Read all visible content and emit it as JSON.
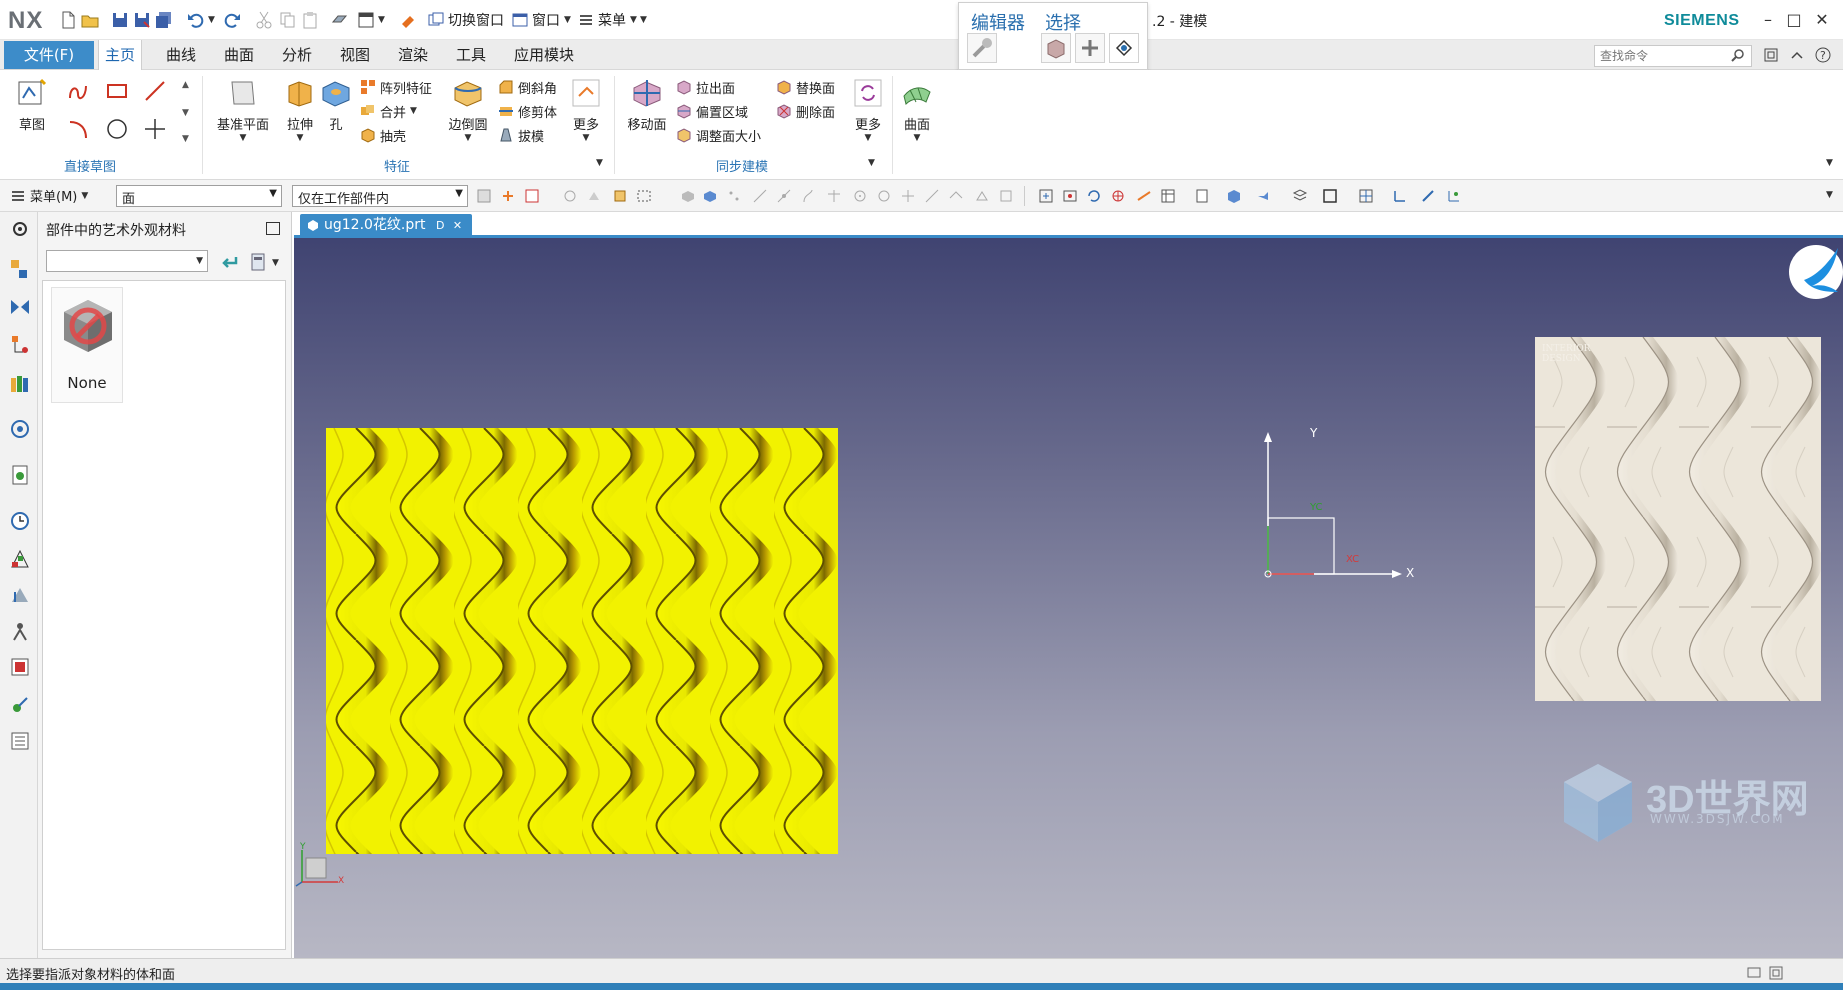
{
  "app": {
    "logo": "NX",
    "title_fragment": ".2 - 建模",
    "brand": "SIEMENS"
  },
  "titlebar": {
    "switch_window": "切换窗口",
    "window_menu": "窗口",
    "menu": "菜单"
  },
  "context_panel": {
    "editor_label": "编辑器",
    "select_label": "选择"
  },
  "ribbon_tabs": {
    "file": "文件(F)",
    "tabs": [
      "主页",
      "曲线",
      "曲面",
      "分析",
      "视图",
      "渲染",
      "工具",
      "应用模块"
    ],
    "active": "主页",
    "search_placeholder": "查找命令"
  },
  "ribbon": {
    "sketch": "草图",
    "group_direct_sketch": "直接草图",
    "datum_plane": "基准平面",
    "extrude": "拉伸",
    "hole": "孔",
    "pattern_feature": "阵列特征",
    "unite": "合并",
    "shell": "抽壳",
    "edge_blend": "边倒圆",
    "chamfer": "倒斜角",
    "trim_body": "修剪体",
    "draft": "拔模",
    "more1": "更多",
    "group_feature": "特征",
    "move_face": "移动面",
    "pull_face": "拉出面",
    "offset_region": "偏置区域",
    "resize_face": "调整面大小",
    "replace_face": "替换面",
    "delete_face": "删除面",
    "more2": "更多",
    "group_sync": "同步建模",
    "surface": "曲面"
  },
  "selbar": {
    "menu_label": "菜单(M)",
    "filter_value": "面",
    "scope_value": "仅在工作部件内"
  },
  "side_panel": {
    "title": "部件中的艺术外观材料",
    "material_none": "None"
  },
  "document": {
    "tab_label": "ug12.0花纹.prt"
  },
  "viewport": {
    "axis_x": "X",
    "axis_y": "Y",
    "axis_xc": "XC",
    "axis_yc": "YC",
    "mini_x": "X",
    "mini_y": "Y",
    "ref_image_text": "INTERIOR DESIGN",
    "watermark": "3D世界网",
    "watermark_sub": "WWW.3DSJW.COM"
  },
  "status": {
    "prompt": "选择要指派对象材料的体和面"
  },
  "colors": {
    "accent": "#3d8cc9",
    "pattern_yellow": "#f2f200",
    "brand": "#0f8b9a"
  }
}
